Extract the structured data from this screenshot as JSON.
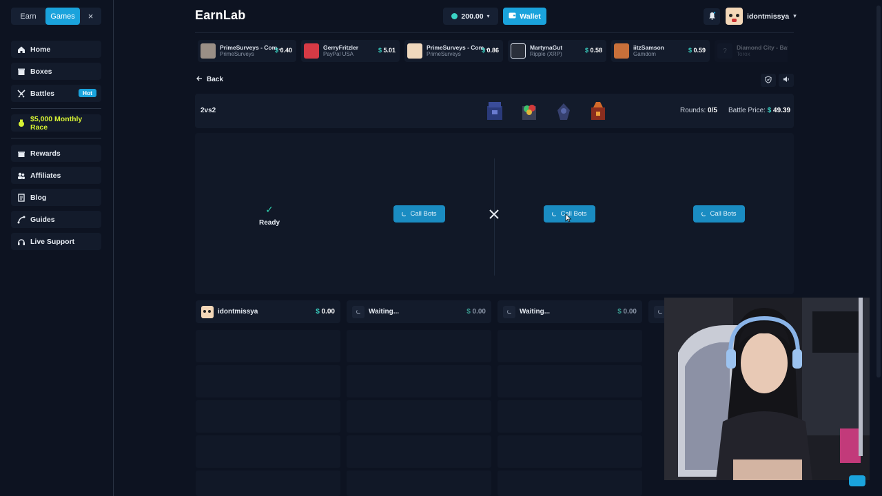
{
  "sidebar": {
    "tabs": [
      {
        "label": "Earn"
      },
      {
        "label": "Games"
      },
      {
        "label": "×"
      }
    ],
    "items": [
      {
        "label": "Home",
        "icon": "home-icon"
      },
      {
        "label": "Boxes",
        "icon": "box-icon"
      },
      {
        "label": "Battles",
        "icon": "swords-icon",
        "badge": "Hot"
      },
      {
        "label": "$5,000 Monthly Race",
        "icon": "medal-icon"
      },
      {
        "label": "Rewards",
        "icon": "gift-icon"
      },
      {
        "label": "Affiliates",
        "icon": "users-icon"
      },
      {
        "label": "Blog",
        "icon": "blog-icon"
      },
      {
        "label": "Guides",
        "icon": "guides-icon"
      },
      {
        "label": "Live Support",
        "icon": "headset-icon"
      }
    ]
  },
  "header": {
    "logo": "EarnLab",
    "balance": "200.00",
    "wallet_label": "Wallet",
    "username": "idontmissya"
  },
  "ticker": [
    {
      "name": "PrimeSurveys - Com...",
      "source": "PrimeSurveys",
      "amount": "0.40"
    },
    {
      "name": "GerryFritzler",
      "source": "PayPal USA",
      "amount": "5.01"
    },
    {
      "name": "PrimeSurveys - Com...",
      "source": "PrimeSurveys",
      "amount": "0.86"
    },
    {
      "name": "MartynaGut",
      "source": "Ripple (XRP)",
      "amount": "0.58"
    },
    {
      "name": "iitzSamson",
      "source": "Gamdom",
      "amount": "0.59"
    },
    {
      "name": "Diamond City - Bat...",
      "source": "Torox",
      "amount": ""
    }
  ],
  "nav": {
    "back_label": "Back"
  },
  "battle": {
    "mode": "2vs2",
    "rounds_label": "Rounds:",
    "rounds_value": "0/5",
    "price_label": "Battle Price:",
    "price_value": "49.39",
    "ready_label": "Ready",
    "call_bots_label": "Call Bots"
  },
  "players": [
    {
      "name": "idontmissya",
      "amount": "0.00"
    },
    {
      "name": "Waiting...",
      "amount": "0.00"
    },
    {
      "name": "Waiting...",
      "amount": "0.00"
    }
  ],
  "colors": {
    "accent": "#1aa3dc",
    "teal": "#3ad3c4",
    "race": "#d7f233",
    "bg": "#0d1321"
  }
}
